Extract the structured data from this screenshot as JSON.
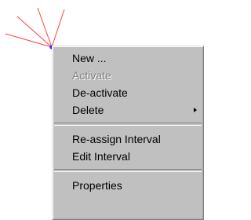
{
  "menu": {
    "items": [
      {
        "label": "New ...",
        "enabled": true
      },
      {
        "label": "Activate",
        "enabled": false
      },
      {
        "label": "De-activate",
        "enabled": true
      },
      {
        "label": "Delete",
        "enabled": true,
        "submenu": true
      },
      {
        "label": "Re-assign Interval",
        "enabled": true
      },
      {
        "label": "Edit Interval",
        "enabled": true
      },
      {
        "label": "Properties",
        "enabled": true
      }
    ]
  },
  "colors": {
    "menu_background": "#c0c0c0",
    "disabled_text": "#808080",
    "line_color": "#ff4040",
    "node_color": "#2a2aff"
  },
  "icons": {
    "submenu_arrow": "triangle-right-icon",
    "node": "blue-dot-icon"
  }
}
